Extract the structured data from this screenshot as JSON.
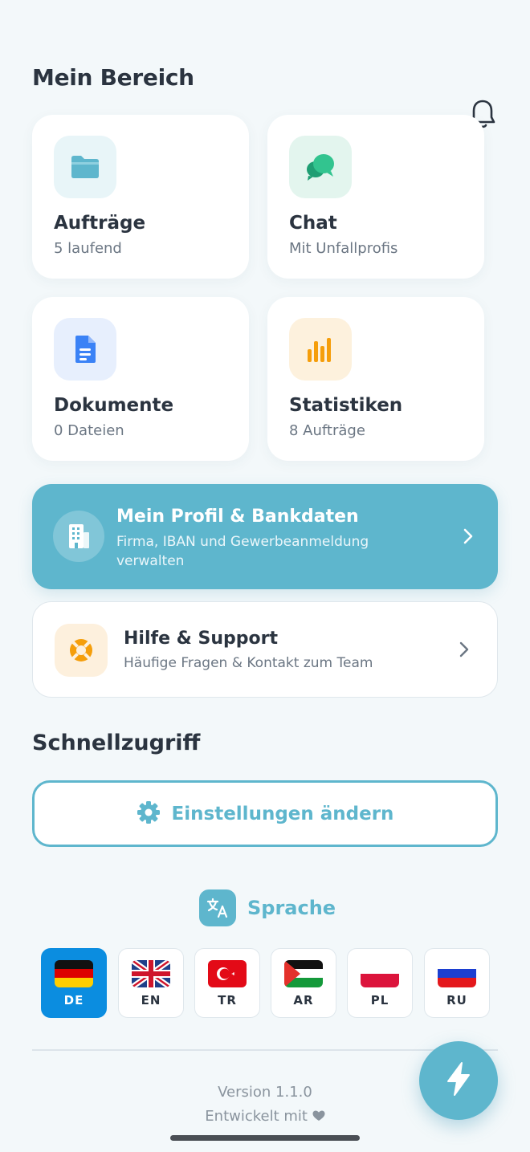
{
  "header": {
    "title": "Mein Bereich"
  },
  "cards": [
    {
      "title": "Aufträge",
      "subtitle": "5 laufend",
      "icon": "folder-icon",
      "color": "#5eb6cd",
      "bg": "#e8f5f8"
    },
    {
      "title": "Chat",
      "subtitle": "Mit Unfallprofis",
      "icon": "chat-bubbles-icon",
      "color": "#28b385",
      "bg": "#e3f5ee"
    },
    {
      "title": "Dokumente",
      "subtitle": "0 Dateien",
      "icon": "document-icon",
      "color": "#3b82f6",
      "bg": "#e7effd"
    },
    {
      "title": "Statistiken",
      "subtitle": "8 Aufträge",
      "icon": "bar-chart-icon",
      "color": "#f59e0b",
      "bg": "#fdf1dd"
    }
  ],
  "profile": {
    "title": "Mein Profil & Bankdaten",
    "subtitle": "Firma, IBAN und Gewerbeanmeldung verwalten",
    "icon": "building-icon"
  },
  "support": {
    "title": "Hilfe & Support",
    "subtitle": "Häufige Fragen & Kontakt zum Team",
    "icon": "lifebuoy-icon"
  },
  "quick": {
    "title": "Schnellzugriff",
    "settings_label": "Einstellungen ändern"
  },
  "language": {
    "title": "Sprache",
    "options": [
      {
        "code": "DE",
        "flag": "germany-flag",
        "active": true
      },
      {
        "code": "EN",
        "flag": "uk-flag",
        "active": false
      },
      {
        "code": "TR",
        "flag": "turkey-flag",
        "active": false
      },
      {
        "code": "AR",
        "flag": "arabic-flag",
        "active": false
      },
      {
        "code": "PL",
        "flag": "poland-flag",
        "active": false
      },
      {
        "code": "RU",
        "flag": "russia-flag",
        "active": false
      }
    ]
  },
  "footer": {
    "version": "Version 1.1.0",
    "made_with": "Entwickelt mit"
  },
  "colors": {
    "accent": "#5eb6cd",
    "active_language": "#0b8de0",
    "background": "#f3f8fa"
  }
}
